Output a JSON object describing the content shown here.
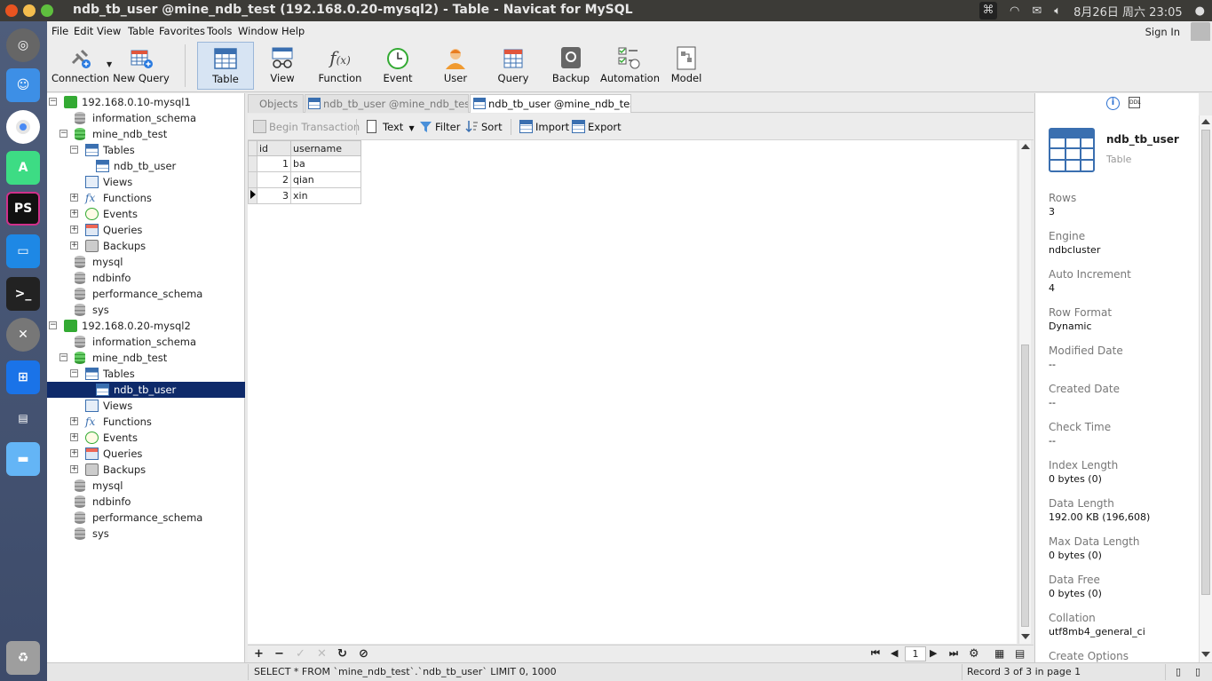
{
  "window": {
    "title": "ndb_tb_user @mine_ndb_test (192.168.0.20-mysql2) - Table - Navicat for MySQL",
    "clock": "8月26日 周六 23:05"
  },
  "menu": {
    "items": [
      "File",
      "Edit",
      "View",
      "Table",
      "Favorites",
      "Tools",
      "Window",
      "Help"
    ],
    "sign_in": "Sign In"
  },
  "toolbar": {
    "buttons": [
      {
        "label": "Connection",
        "icon": "plug-icon"
      },
      {
        "label": "New Query",
        "icon": "new-query-icon"
      },
      {
        "label": "Table",
        "icon": "table-icon"
      },
      {
        "label": "View",
        "icon": "view-glasses-icon"
      },
      {
        "label": "Function",
        "icon": "function-fx-icon"
      },
      {
        "label": "Event",
        "icon": "clock-icon"
      },
      {
        "label": "User",
        "icon": "user-icon"
      },
      {
        "label": "Query",
        "icon": "query-icon"
      },
      {
        "label": "Backup",
        "icon": "backup-icon"
      },
      {
        "label": "Automation",
        "icon": "checklist-icon"
      },
      {
        "label": "Model",
        "icon": "model-icon"
      }
    ]
  },
  "tree": {
    "nodes": [
      {
        "label": "192.168.0.10-mysql1",
        "kind": "server"
      },
      {
        "label": "information_schema",
        "kind": "db"
      },
      {
        "label": "mine_ndb_test",
        "kind": "db-open"
      },
      {
        "label": "Tables",
        "kind": "tables"
      },
      {
        "label": "ndb_tb_user",
        "kind": "table"
      },
      {
        "label": "Views",
        "kind": "views"
      },
      {
        "label": "Functions",
        "kind": "functions"
      },
      {
        "label": "Events",
        "kind": "events"
      },
      {
        "label": "Queries",
        "kind": "queries"
      },
      {
        "label": "Backups",
        "kind": "backups"
      },
      {
        "label": "mysql",
        "kind": "db"
      },
      {
        "label": "ndbinfo",
        "kind": "db"
      },
      {
        "label": "performance_schema",
        "kind": "db"
      },
      {
        "label": "sys",
        "kind": "db"
      },
      {
        "label": "192.168.0.20-mysql2",
        "kind": "server"
      },
      {
        "label": "information_schema",
        "kind": "db"
      },
      {
        "label": "mine_ndb_test",
        "kind": "db-open"
      },
      {
        "label": "Tables",
        "kind": "tables"
      },
      {
        "label": "ndb_tb_user",
        "kind": "table"
      },
      {
        "label": "Views",
        "kind": "views"
      },
      {
        "label": "Functions",
        "kind": "functions"
      },
      {
        "label": "Events",
        "kind": "events"
      },
      {
        "label": "Queries",
        "kind": "queries"
      },
      {
        "label": "Backups",
        "kind": "backups"
      },
      {
        "label": "mysql",
        "kind": "db"
      },
      {
        "label": "ndbinfo",
        "kind": "db"
      },
      {
        "label": "performance_schema",
        "kind": "db"
      },
      {
        "label": "sys",
        "kind": "db"
      }
    ],
    "selected_label": "ndb_tb_user"
  },
  "tabs": [
    {
      "label": "Objects"
    },
    {
      "label": "ndb_tb_user @mine_ndb_test ..."
    },
    {
      "label": "ndb_tb_user @mine_ndb_test ..."
    }
  ],
  "objbar": {
    "begin_transaction": "Begin Transaction",
    "text": "Text",
    "filter": "Filter",
    "sort": "Sort",
    "import": "Import",
    "export": "Export"
  },
  "grid": {
    "columns": [
      "id",
      "username"
    ],
    "rows": [
      {
        "id": "1",
        "username": "ba"
      },
      {
        "id": "2",
        "username": "qian"
      },
      {
        "id": "3",
        "username": "xin"
      }
    ],
    "page": "1"
  },
  "status": {
    "sql": "SELECT * FROM `mine_ndb_test`.`ndb_tb_user` LIMIT 0, 1000",
    "record": "Record 3 of 3 in page 1"
  },
  "info": {
    "table_name": "ndb_tb_user",
    "table_type": "Table",
    "ddl_label": "DDL",
    "properties": [
      {
        "key": "Rows",
        "value": "3"
      },
      {
        "key": "Engine",
        "value": "ndbcluster"
      },
      {
        "key": "Auto Increment",
        "value": "4"
      },
      {
        "key": "Row Format",
        "value": "Dynamic"
      },
      {
        "key": "Modified Date",
        "value": "--"
      },
      {
        "key": "Created Date",
        "value": "--"
      },
      {
        "key": "Check Time",
        "value": "--"
      },
      {
        "key": "Index Length",
        "value": "0 bytes (0)"
      },
      {
        "key": "Data Length",
        "value": "192.00 KB (196,608)"
      },
      {
        "key": "Max Data Length",
        "value": "0 bytes (0)"
      },
      {
        "key": "Data Free",
        "value": "0 bytes (0)"
      },
      {
        "key": "Collation",
        "value": "utf8mb4_general_ci"
      },
      {
        "key": "Create Options",
        "value": ""
      }
    ]
  },
  "colors": {
    "selection": "#0e2a6a",
    "accent": "#3a6fb0",
    "titlebar": "#3c3b37"
  }
}
